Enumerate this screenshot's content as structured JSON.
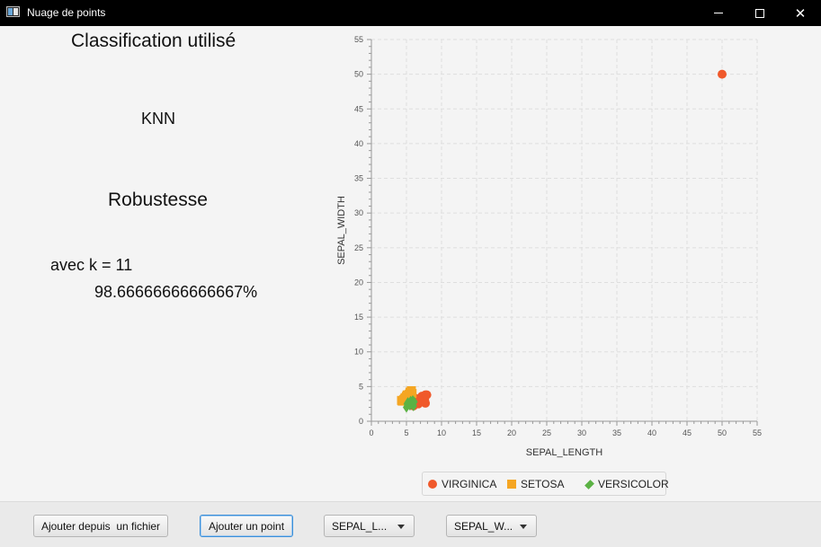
{
  "window": {
    "title": "Nuage de points"
  },
  "panel": {
    "classification_title": "Classification utilisé",
    "classification_value": "KNN",
    "robustness_title": "Robustesse",
    "k_text": "avec k = 11",
    "robustness_value": "98.66666666666667%"
  },
  "toolbar": {
    "add_file_label": "Ajouter depuis  un fichier",
    "add_point_label": "Ajouter un point",
    "x_select_value": "SEPAL_L...",
    "y_select_value": "SEPAL_W..."
  },
  "chart_data": {
    "type": "scatter",
    "xlabel": "SEPAL_LENGTH",
    "ylabel": "SEPAL_WIDTH",
    "xlim": [
      0,
      55
    ],
    "ylim": [
      0,
      55
    ],
    "x_ticks": [
      0,
      5,
      10,
      15,
      20,
      25,
      30,
      35,
      40,
      45,
      50,
      55
    ],
    "y_ticks": [
      0,
      5,
      10,
      15,
      20,
      25,
      30,
      35,
      40,
      45,
      50,
      55
    ],
    "grid": true,
    "legend_position": "bottom",
    "series": [
      {
        "name": "VIRGINICA",
        "color": "#f0592b",
        "marker": "circle",
        "points": [
          [
            6.3,
            3.3
          ],
          [
            5.8,
            2.7
          ],
          [
            7.1,
            3.0
          ],
          [
            6.5,
            3.0
          ],
          [
            7.6,
            3.0
          ],
          [
            7.3,
            2.9
          ],
          [
            6.7,
            2.5
          ],
          [
            7.2,
            3.6
          ],
          [
            7.7,
            3.8
          ],
          [
            6.9,
            3.2
          ],
          [
            6.4,
            2.8
          ],
          [
            6.8,
            3.0
          ],
          [
            7.7,
            2.6
          ],
          [
            6.0,
            2.2
          ],
          [
            6.3,
            2.7
          ],
          [
            7.9,
            3.8
          ],
          [
            6.1,
            3.0
          ],
          [
            50,
            50
          ]
        ]
      },
      {
        "name": "SETOSA",
        "color": "#f5a623",
        "marker": "square",
        "points": [
          [
            5.1,
            3.5
          ],
          [
            4.9,
            3.0
          ],
          [
            4.7,
            3.2
          ],
          [
            4.6,
            3.1
          ],
          [
            5.0,
            3.6
          ],
          [
            5.4,
            3.9
          ],
          [
            4.4,
            2.9
          ],
          [
            5.4,
            3.7
          ],
          [
            4.8,
            3.4
          ],
          [
            5.8,
            4.0
          ],
          [
            5.7,
            4.4
          ],
          [
            5.2,
            3.5
          ],
          [
            4.3,
            3.0
          ],
          [
            5.5,
            4.2
          ],
          [
            5.1,
            3.8
          ],
          [
            5.0,
            3.3
          ]
        ]
      },
      {
        "name": "VERSICOLOR",
        "color": "#5bb244",
        "marker": "diamond",
        "points": [
          [
            5.5,
            2.3
          ],
          [
            5.0,
            2.0
          ],
          [
            5.9,
            3.0
          ],
          [
            6.0,
            2.2
          ],
          [
            5.6,
            2.9
          ],
          [
            5.7,
            2.6
          ],
          [
            5.2,
            2.7
          ],
          [
            5.8,
            2.7
          ],
          [
            6.1,
            2.8
          ],
          [
            5.1,
            2.5
          ],
          [
            5.6,
            2.5
          ]
        ]
      }
    ]
  }
}
